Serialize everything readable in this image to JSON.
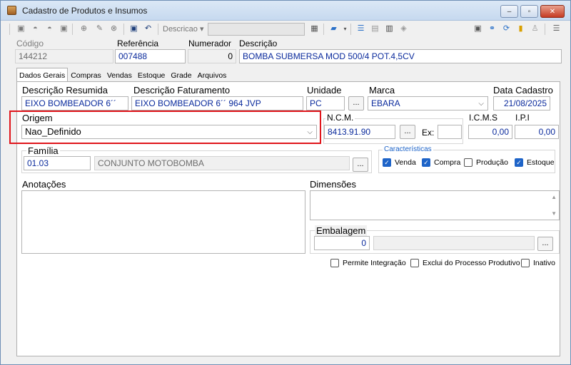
{
  "window": {
    "title": "Cadastro de Produtos e Insumos",
    "controls": {
      "minimize": "–",
      "maximize": "▫",
      "close": "✕"
    }
  },
  "toolbar": {
    "dropdown_label": "Descricao",
    "dropdown_arrow": "▾",
    "search_value": ""
  },
  "header": {
    "codigo_label": "Código",
    "codigo_value": "144212",
    "referencia_label": "Referência",
    "referencia_value": "007488",
    "numerador_label": "Numerador",
    "numerador_value": "0",
    "descricao_label": "Descrição",
    "descricao_value": "BOMBA SUBMERSA MOD 500/4 POT.4,5CV"
  },
  "tabs": [
    "Dados Gerais",
    "Compras",
    "Vendas",
    "Estoque",
    "Grade",
    "Arquivos"
  ],
  "form": {
    "descricao_resumida_label": "Descrição Resumida",
    "descricao_resumida_value": "EIXO BOMBEADOR 6´´",
    "descricao_faturamento_label": "Descrição Faturamento",
    "descricao_faturamento_value": "EIXO BOMBEADOR 6´´ 964 JVP",
    "unidade_label": "Unidade",
    "unidade_value": "PC",
    "marca_label": "Marca",
    "marca_value": "EBARA",
    "data_cadastro_label": "Data Cadastro",
    "data_cadastro_value": "21/08/2025",
    "origem_label": "Origem",
    "origem_value": "Nao_Definido",
    "ncm_label": "N.C.M.",
    "ncm_value": "8413.91.90",
    "ex_label": "Ex:",
    "ex_value": "",
    "icms_label": "I.C.M.S",
    "icms_value": "0,00",
    "ipi_label": "I.P.I",
    "ipi_value": "0,00",
    "familia_label": "Família",
    "familia_code": "01.03",
    "familia_name": "CONJUNTO MOTOBOMBA",
    "caracteristicas_label": "Características",
    "caracteristicas": [
      {
        "label": "Venda",
        "checked": true
      },
      {
        "label": "Compra",
        "checked": true
      },
      {
        "label": "Produção",
        "checked": false
      },
      {
        "label": "Estoque",
        "checked": true
      }
    ],
    "anotacoes_label": "Anotações",
    "dimensoes_label": "Dimensões",
    "embalagem_label": "Embalagem",
    "embalagem_value": "0",
    "dots": "...",
    "flags": [
      {
        "label": "Permite Integração",
        "checked": false
      },
      {
        "label": "Exclui do Processo Produtivo",
        "checked": false
      },
      {
        "label": "Inativo",
        "checked": false
      }
    ]
  },
  "colors": {
    "highlight": "#e0151b",
    "field_text": "#0a2a9c",
    "checkbox_on": "#1e64c8"
  }
}
